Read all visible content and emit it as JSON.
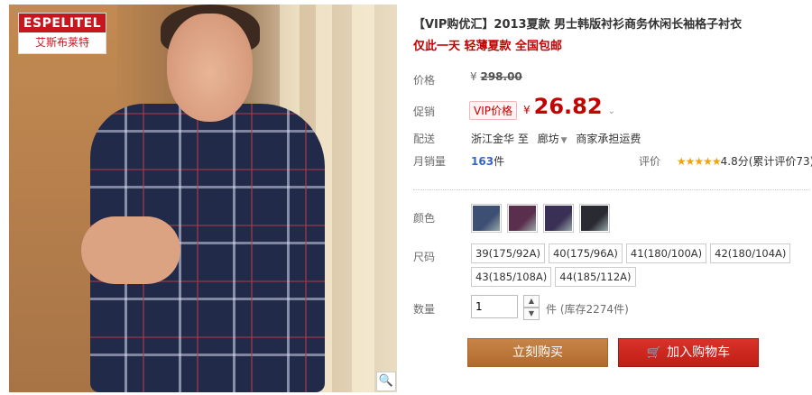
{
  "image": {
    "logo_brand": "ESPELITEL",
    "logo_cn": "艾斯布莱特",
    "zoom_icon": "magnifier-icon"
  },
  "product": {
    "title": "【VIP购优汇】2013夏款 男士韩版衬衫商务休闲长袖格子衬衣",
    "subtitle": "仅此一天 轻薄夏款 全国包邮"
  },
  "price": {
    "label": "价格",
    "currency": "¥",
    "original": "298.00",
    "promo_label": "促销",
    "vip_tag": "VIP价格",
    "current": "26.82"
  },
  "delivery": {
    "label": "配送",
    "from": "浙江金华 至",
    "to": "廊坊",
    "fee_note": "商家承担运费"
  },
  "sales": {
    "label": "月销量",
    "count": "163",
    "unit": "件",
    "rating_label": "评价",
    "stars": "★★★★★",
    "score": "4.8分",
    "reviews": "(累计评价73)"
  },
  "color": {
    "label": "颜色",
    "options": [
      "#3d4f73",
      "#5a2f4e",
      "#3a2f55",
      "#2a2a33"
    ]
  },
  "size": {
    "label": "尺码",
    "options": [
      "39(175/92A)",
      "40(175/96A)",
      "41(180/100A)",
      "42(180/104A)",
      "43(185/108A)",
      "44(185/112A)"
    ]
  },
  "quantity": {
    "label": "数量",
    "value": "1",
    "unit": "件",
    "stock": "(库存2274件)"
  },
  "actions": {
    "buy_now": "立刻购买",
    "add_to_cart": "加入购物车"
  },
  "colors": {
    "accent_red": "#c40000",
    "buy_button": "#b87333",
    "cart_button": "#c8221a"
  }
}
